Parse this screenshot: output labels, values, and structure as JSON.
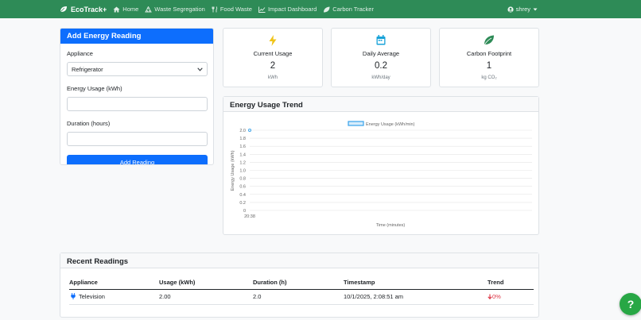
{
  "nav": {
    "brand": "EcoTrack+",
    "links": [
      {
        "label": "Home",
        "icon": "home-icon"
      },
      {
        "label": "Waste Segregation",
        "icon": "recycle-icon"
      },
      {
        "label": "Food Waste",
        "icon": "utensils-icon"
      },
      {
        "label": "Impact Dashboard",
        "icon": "chart-icon"
      },
      {
        "label": "Carbon Tracker",
        "icon": "leaf-icon"
      }
    ],
    "user": "shrey"
  },
  "form": {
    "title": "Add Energy Reading",
    "appliance_label": "Appliance",
    "appliance_value": "Refrigerator",
    "usage_label": "Energy Usage (kWh)",
    "usage_value": "",
    "duration_label": "Duration (hours)",
    "duration_value": "",
    "submit_label": "Add Reading"
  },
  "stats": [
    {
      "title": "Current Usage",
      "value": "2",
      "unit": "kWh",
      "icon": "bolt-icon",
      "color": "#f0c419"
    },
    {
      "title": "Daily Average",
      "value": "0.2",
      "unit": "kWh/day",
      "icon": "calendar-icon",
      "color": "#17a2d8"
    },
    {
      "title": "Carbon Footprint",
      "value": "1",
      "unit": "kg CO₂",
      "icon": "leaf-icon",
      "color": "#2e8b57"
    }
  ],
  "chart": {
    "title": "Energy Usage Trend"
  },
  "chart_data": {
    "type": "line",
    "series": [
      {
        "name": "Energy Usage (kWh/min)",
        "x": [
          "20:38"
        ],
        "values": [
          2.0
        ]
      }
    ],
    "xlabel": "Time (minutes)",
    "ylabel": "Energy Usage (kWh)",
    "ylim": [
      0,
      2.0
    ],
    "yticks": [
      "0",
      "0.2",
      "0.4",
      "0.6",
      "0.8",
      "1.0",
      "1.2",
      "1.4",
      "1.6",
      "1.8",
      "2.0"
    ],
    "xticks": [
      "20:38"
    ],
    "grid": true,
    "legend": "top-center",
    "color": "#36a2eb"
  },
  "recent": {
    "title": "Recent Readings",
    "columns": [
      "Appliance",
      "Usage (kWh)",
      "Duration (h)",
      "Timestamp",
      "Trend"
    ],
    "rows": [
      {
        "appliance": "Television",
        "usage": "2.00",
        "duration": "2.0",
        "timestamp": "10/1/2025, 2:08:51 am",
        "trend": "0%"
      }
    ]
  },
  "help_label": "?"
}
